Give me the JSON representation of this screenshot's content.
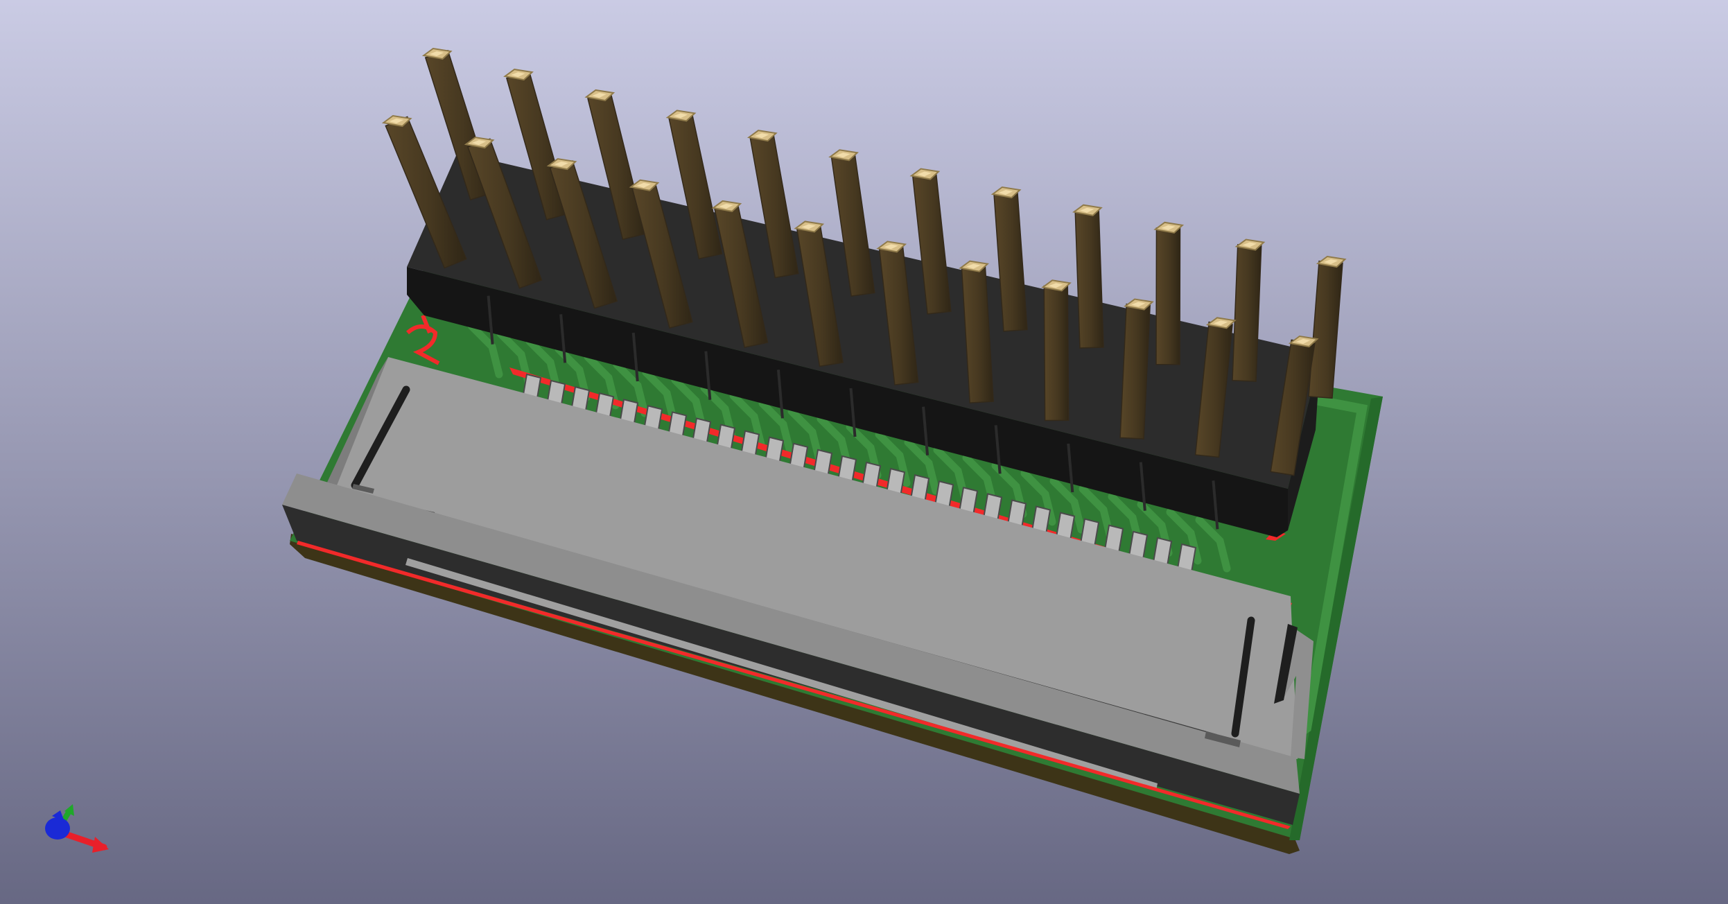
{
  "viewer": {
    "colors": {
      "background_top": "#cacbe4",
      "background_bottom": "#676883",
      "pcb_green": "#2f7a33",
      "pcb_green_dark": "#1f5c24",
      "pcb_trace": "#3f9242",
      "pcb_side": "#3d3417",
      "courtyard_red": "#f22a2a",
      "connector_gray": "#9d9d9d",
      "connector_gray_dark": "#6e6e6e",
      "connector_shadow": "#3a3a3a",
      "header_black": "#2a2a2a",
      "header_black_top": "#333333",
      "pin_brass": "#4a3c22",
      "pin_brass_dark": "#33291a",
      "pin_tip": "#d8bf88",
      "axis_x": "#e8202a",
      "axis_y": "#1fa82a",
      "axis_z": "#1a2ad6"
    },
    "header_pin_count": 24,
    "ffc_contact_count": 28,
    "silkscreen_ref": "J2"
  }
}
